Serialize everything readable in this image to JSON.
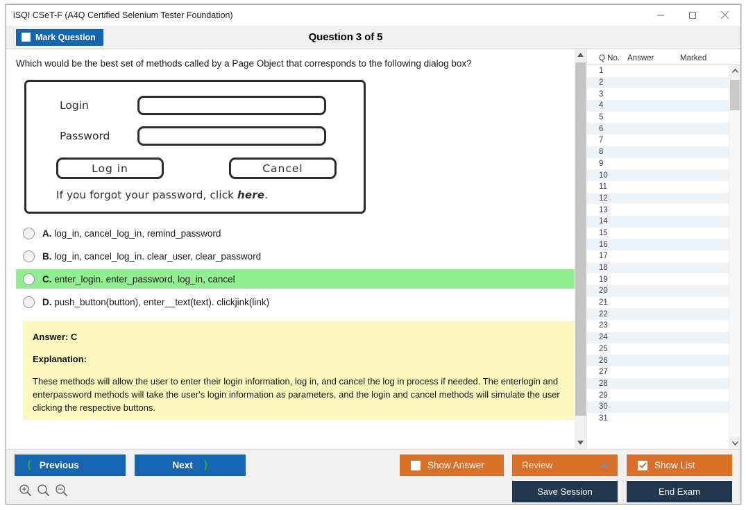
{
  "window": {
    "title": "iSQI CSeT-F (A4Q Certified Selenium Tester Foundation)",
    "minimize_label": "minimize",
    "maximize_label": "maximize",
    "close_label": "close"
  },
  "header": {
    "mark_question_label": "Mark Question",
    "mark_question_checked": false,
    "question_counter": "Question 3 of 5"
  },
  "question": {
    "text": "Which would be the best set of methods called by a Page Object that corresponds to the following dialog box?",
    "dialog_mock": {
      "login_label": "Login",
      "password_label": "Password",
      "login_value": "",
      "password_value": "",
      "login_button": "Log in",
      "cancel_button": "Cancel",
      "hint_prefix": "If you forgot your password, click ",
      "hint_link": "here",
      "hint_suffix": "."
    },
    "options": [
      {
        "letter": "A.",
        "text": "log_in, cancel_log_in, remind_password",
        "selected": false
      },
      {
        "letter": "B.",
        "text": "log_in, cancel_log_in. clear_user, clear_password",
        "selected": false
      },
      {
        "letter": "C.",
        "text": "enter_login. enter_password, log_in, cancel",
        "selected": true
      },
      {
        "letter": "D.",
        "text": "push_button(button), enter__text(text). clickjink(link)",
        "selected": false
      }
    ]
  },
  "answer_panel": {
    "answer_heading": "Answer: C",
    "explanation_heading": "Explanation:",
    "explanation_body": "These methods will allow the user to enter their login information, log in, and cancel the log in process if needed. The enterlogin and enterpassword methods will take the user's login information as parameters, and the login and cancel methods will simulate the user clicking the respective buttons."
  },
  "question_list": {
    "columns": [
      "Q No.",
      "Answer",
      "Marked"
    ],
    "rows": [
      {
        "qno": "1",
        "answer": "",
        "marked": ""
      },
      {
        "qno": "2",
        "answer": "",
        "marked": ""
      },
      {
        "qno": "3",
        "answer": "",
        "marked": ""
      },
      {
        "qno": "4",
        "answer": "",
        "marked": ""
      },
      {
        "qno": "5",
        "answer": "",
        "marked": ""
      },
      {
        "qno": "6",
        "answer": "",
        "marked": ""
      },
      {
        "qno": "7",
        "answer": "",
        "marked": ""
      },
      {
        "qno": "8",
        "answer": "",
        "marked": ""
      },
      {
        "qno": "9",
        "answer": "",
        "marked": ""
      },
      {
        "qno": "10",
        "answer": "",
        "marked": ""
      },
      {
        "qno": "11",
        "answer": "",
        "marked": ""
      },
      {
        "qno": "12",
        "answer": "",
        "marked": ""
      },
      {
        "qno": "13",
        "answer": "",
        "marked": ""
      },
      {
        "qno": "14",
        "answer": "",
        "marked": ""
      },
      {
        "qno": "15",
        "answer": "",
        "marked": ""
      },
      {
        "qno": "16",
        "answer": "",
        "marked": ""
      },
      {
        "qno": "17",
        "answer": "",
        "marked": ""
      },
      {
        "qno": "18",
        "answer": "",
        "marked": ""
      },
      {
        "qno": "19",
        "answer": "",
        "marked": ""
      },
      {
        "qno": "20",
        "answer": "",
        "marked": ""
      },
      {
        "qno": "21",
        "answer": "",
        "marked": ""
      },
      {
        "qno": "22",
        "answer": "",
        "marked": ""
      },
      {
        "qno": "23",
        "answer": "",
        "marked": ""
      },
      {
        "qno": "24",
        "answer": "",
        "marked": ""
      },
      {
        "qno": "25",
        "answer": "",
        "marked": ""
      },
      {
        "qno": "26",
        "answer": "",
        "marked": ""
      },
      {
        "qno": "27",
        "answer": "",
        "marked": ""
      },
      {
        "qno": "28",
        "answer": "",
        "marked": ""
      },
      {
        "qno": "29",
        "answer": "",
        "marked": ""
      },
      {
        "qno": "30",
        "answer": "",
        "marked": ""
      },
      {
        "qno": "31",
        "answer": "",
        "marked": ""
      }
    ]
  },
  "footer": {
    "previous_label": "Previous",
    "next_label": "Next",
    "show_answer_label": "Show Answer",
    "show_answer_checked": false,
    "review_label": "Review",
    "show_list_label": "Show List",
    "show_list_checked": true,
    "save_session_label": "Save Session",
    "end_exam_label": "End Exam"
  },
  "colors": {
    "primary_blue": "#1565b0",
    "accent_orange": "#d9702a",
    "navy": "#22384e",
    "selected_green": "#90ee90",
    "answer_yellow": "#fdf8bd",
    "chevron_green": "#2fb62f"
  }
}
